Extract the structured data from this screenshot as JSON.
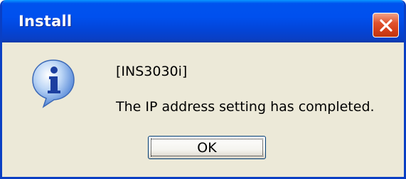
{
  "dialog": {
    "title": "Install",
    "heading": "[INS3030i]",
    "message": "The IP address setting has completed.",
    "ok_label": "OK"
  },
  "icons": {
    "close": "close-icon",
    "info": "information-icon"
  },
  "colors": {
    "titlebar": "#0053ee",
    "window_frame": "#0a3fc4",
    "dialog_background": "#ece9d8",
    "close_button": "#e0532f"
  }
}
